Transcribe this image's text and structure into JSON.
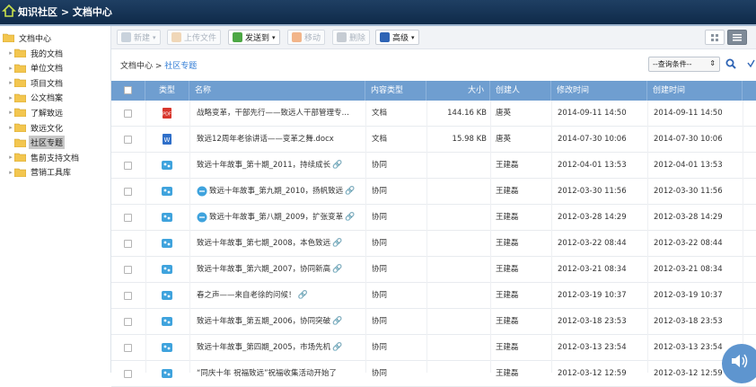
{
  "header": {
    "title": "知识社区 > 文档中心"
  },
  "sidebar": {
    "root": "文档中心",
    "items": [
      {
        "label": "我的文档",
        "expandable": true
      },
      {
        "label": "单位文档",
        "expandable": true
      },
      {
        "label": "项目文档",
        "expandable": true
      },
      {
        "label": "公文档案",
        "expandable": true
      },
      {
        "label": "了解致远",
        "expandable": true
      },
      {
        "label": "致远文化",
        "expandable": true
      },
      {
        "label": "社区专题",
        "expandable": false
      },
      {
        "label": "售前支持文档",
        "expandable": true
      },
      {
        "label": "营销工具库",
        "expandable": true
      }
    ]
  },
  "toolbar": {
    "new_label": "新建",
    "upload_label": "上传文件",
    "send_label": "发送到",
    "move_label": "移动",
    "delete_label": "删除",
    "advanced_label": "高级"
  },
  "breadcrumb": {
    "root": "文档中心",
    "sep": " > ",
    "current": "社区专题"
  },
  "query": {
    "label": "--查询条件--"
  },
  "table": {
    "headers": {
      "type": "类型",
      "name": "名称",
      "content_type": "内容类型",
      "size": "大小",
      "creator": "创建人",
      "modified": "修改时间",
      "created": "创建时间"
    },
    "rows": [
      {
        "icon": "pdf",
        "name": "战略变革，干部先行——致远人干部管理专…",
        "content_type": "文档",
        "size": "144.16 KB",
        "creator": "唐英",
        "modified": "2014-09-11 14:50",
        "created": "2014-09-11 14:50",
        "clip": false
      },
      {
        "icon": "word",
        "name": "致远12周年老徐讲话——变革之舞.docx",
        "content_type": "文档",
        "size": "15.98 KB",
        "creator": "唐英",
        "modified": "2014-07-30 10:06",
        "created": "2014-07-30 10:06",
        "clip": false
      },
      {
        "icon": "collab",
        "name": "致远十年故事_第十期_2011，持续成长",
        "content_type": "协同",
        "size": "",
        "creator": "王建磊",
        "modified": "2012-04-01 13:53",
        "created": "2012-04-01 13:53",
        "clip": true
      },
      {
        "icon": "collab-link",
        "name": "致远十年故事_第九期_2010，扬帆致远",
        "content_type": "协同",
        "size": "",
        "creator": "王建磊",
        "modified": "2012-03-30 11:56",
        "created": "2012-03-30 11:56",
        "clip": true
      },
      {
        "icon": "collab-link",
        "name": "致远十年故事_第八期_2009，扩张变革",
        "content_type": "协同",
        "size": "",
        "creator": "王建磊",
        "modified": "2012-03-28 14:29",
        "created": "2012-03-28 14:29",
        "clip": true
      },
      {
        "icon": "collab",
        "name": "致远十年故事_第七期_2008，本色致远",
        "content_type": "协同",
        "size": "",
        "creator": "王建磊",
        "modified": "2012-03-22 08:44",
        "created": "2012-03-22 08:44",
        "clip": true
      },
      {
        "icon": "collab",
        "name": "致远十年故事_第六期_2007，协同新高",
        "content_type": "协同",
        "size": "",
        "creator": "王建磊",
        "modified": "2012-03-21 08:34",
        "created": "2012-03-21 08:34",
        "clip": true
      },
      {
        "icon": "collab",
        "name": "春之声——来自老徐的问候！",
        "content_type": "协同",
        "size": "",
        "creator": "王建磊",
        "modified": "2012-03-19 10:37",
        "created": "2012-03-19 10:37",
        "clip": true
      },
      {
        "icon": "collab",
        "name": "致远十年故事_第五期_2006，协同突破",
        "content_type": "协同",
        "size": "",
        "creator": "王建磊",
        "modified": "2012-03-18 23:53",
        "created": "2012-03-18 23:53",
        "clip": true
      },
      {
        "icon": "collab",
        "name": "致远十年故事_第四期_2005，市场先机",
        "content_type": "协同",
        "size": "",
        "creator": "王建磊",
        "modified": "2012-03-13 23:54",
        "created": "2012-03-13 23:54",
        "clip": true
      },
      {
        "icon": "collab",
        "name": "“同庆十年 祝福致远”祝福收集活动开始了",
        "content_type": "协同",
        "size": "",
        "creator": "王建磊",
        "modified": "2012-03-12 12:59",
        "created": "2012-03-12 12:59",
        "clip": false
      }
    ]
  },
  "colors": {
    "header_bg": "#0f2a49",
    "table_header": "#6f9ed0",
    "link": "#2f7bd5",
    "folder": "#f2c14e"
  }
}
